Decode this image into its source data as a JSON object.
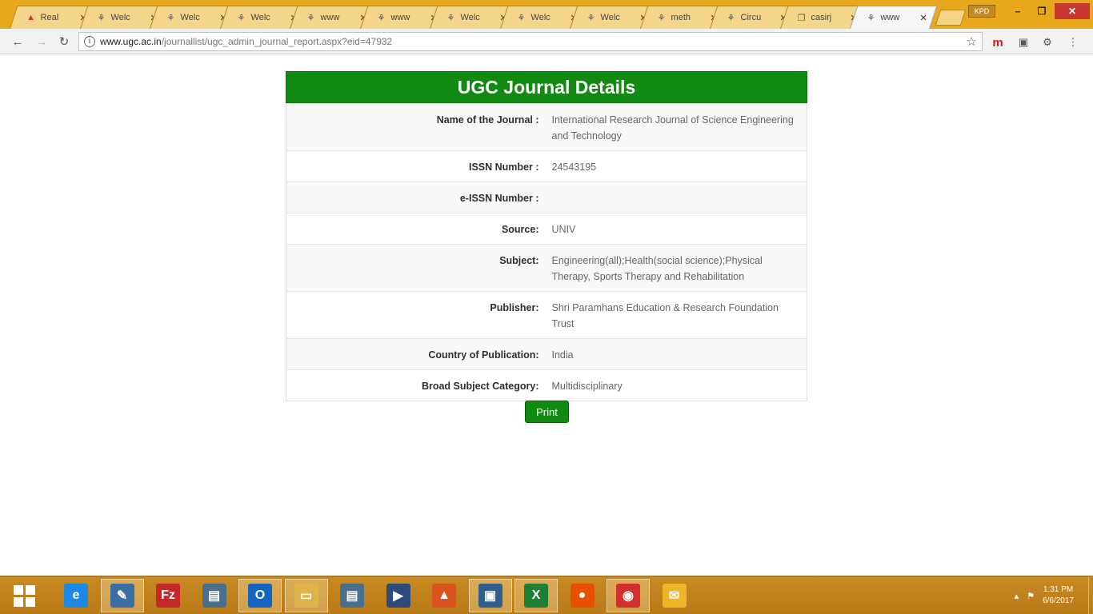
{
  "browser": {
    "tabs": [
      {
        "title": "Real",
        "favicon": "pdf-icon",
        "glyph": "▲",
        "active": false
      },
      {
        "title": "Welc",
        "favicon": "ugc-emblem-icon",
        "glyph": "⚘",
        "active": false
      },
      {
        "title": "Welc",
        "favicon": "ugc-emblem-icon",
        "glyph": "⚘",
        "active": false
      },
      {
        "title": "Welc",
        "favicon": "ugc-emblem-icon",
        "glyph": "⚘",
        "active": false
      },
      {
        "title": "www",
        "favicon": "ugc-emblem-icon",
        "glyph": "⚘",
        "active": false
      },
      {
        "title": "www",
        "favicon": "ugc-emblem-icon",
        "glyph": "⚘",
        "active": false
      },
      {
        "title": "Welc",
        "favicon": "ugc-emblem-icon",
        "glyph": "⚘",
        "active": false
      },
      {
        "title": "Welc",
        "favicon": "ugc-emblem-icon",
        "glyph": "⚘",
        "active": false
      },
      {
        "title": "Welc",
        "favicon": "ugc-emblem-icon",
        "glyph": "⚘",
        "active": false
      },
      {
        "title": "meth",
        "favicon": "ugc-emblem-icon",
        "glyph": "⚘",
        "active": false
      },
      {
        "title": "Circu",
        "favicon": "ugc-emblem-icon",
        "glyph": "⚘",
        "active": false
      },
      {
        "title": "casirj",
        "favicon": "document-icon",
        "glyph": "❐",
        "active": false
      },
      {
        "title": "www",
        "favicon": "ugc-emblem-icon",
        "glyph": "⚘",
        "active": true
      }
    ],
    "tab_close_glyph": "✕",
    "profile_label": "KPD",
    "window": {
      "minimize": "–",
      "restore": "❐",
      "close": "✕"
    },
    "url_host": "www.ugc.ac.in",
    "url_path": "/journallist/ugc_admin_journal_report.aspx?eid=47932",
    "icons": {
      "back": "←",
      "forward": "→",
      "reload": "↻",
      "info": "i",
      "star": "☆",
      "ext_m": "m",
      "ext_bag": "▣",
      "ext_puzzle": "⚙",
      "menu": "⋮"
    }
  },
  "page": {
    "heading": "UGC Journal Details",
    "rows": [
      {
        "label": "Name of the Journal :",
        "value": "International Research Journal of Science Engineering and Technology"
      },
      {
        "label": "ISSN Number :",
        "value": "24543195"
      },
      {
        "label": "e-ISSN Number :",
        "value": ""
      },
      {
        "label": "Source:",
        "value": "UNIV"
      },
      {
        "label": "Subject:",
        "value": "Engineering(all);Health(social science);Physical Therapy, Sports Therapy and Rehabilitation"
      },
      {
        "label": "Publisher:",
        "value": "Shri Paramhans Education & Research Foundation Trust"
      },
      {
        "label": "Country of Publication:",
        "value": "India"
      },
      {
        "label": "Broad Subject Category:",
        "value": "Multidisciplinary"
      }
    ],
    "print_label": "Print"
  },
  "taskbar": {
    "apps": [
      {
        "name": "internet-explorer-icon",
        "glyph": "e",
        "color": "#1e88e5",
        "open": false
      },
      {
        "name": "notepad-app-icon",
        "glyph": "✎",
        "color": "#3a6ea5",
        "open": true
      },
      {
        "name": "filezilla-icon",
        "glyph": "Fz",
        "color": "#c62828",
        "open": false
      },
      {
        "name": "window-app-icon",
        "glyph": "▤",
        "color": "#4a6f8a",
        "open": false
      },
      {
        "name": "outlook-icon",
        "glyph": "O",
        "color": "#1565c0",
        "open": true
      },
      {
        "name": "file-explorer-icon",
        "glyph": "▭",
        "color": "#e0b24a",
        "open": true
      },
      {
        "name": "window-app-2-icon",
        "glyph": "▤",
        "color": "#4a6f8a",
        "open": false
      },
      {
        "name": "media-player-icon",
        "glyph": "▶",
        "color": "#2e4a7a",
        "open": false
      },
      {
        "name": "matlab-icon",
        "glyph": "▲",
        "color": "#d9531e",
        "open": false
      },
      {
        "name": "monitor-app-icon",
        "glyph": "▣",
        "color": "#2f5f8f",
        "open": true
      },
      {
        "name": "excel-icon",
        "glyph": "X",
        "color": "#1e7e34",
        "open": true
      },
      {
        "name": "firefox-icon",
        "glyph": "●",
        "color": "#e65100",
        "open": false
      },
      {
        "name": "chrome-icon",
        "glyph": "◉",
        "color": "#d32f2f",
        "open": true
      },
      {
        "name": "sticky-app-icon",
        "glyph": "✉",
        "color": "#f0b429",
        "open": false
      }
    ],
    "tray_arrow": "▴",
    "tray_flag": "⚑",
    "time": "1:31 PM",
    "date": "6/6/2017"
  }
}
